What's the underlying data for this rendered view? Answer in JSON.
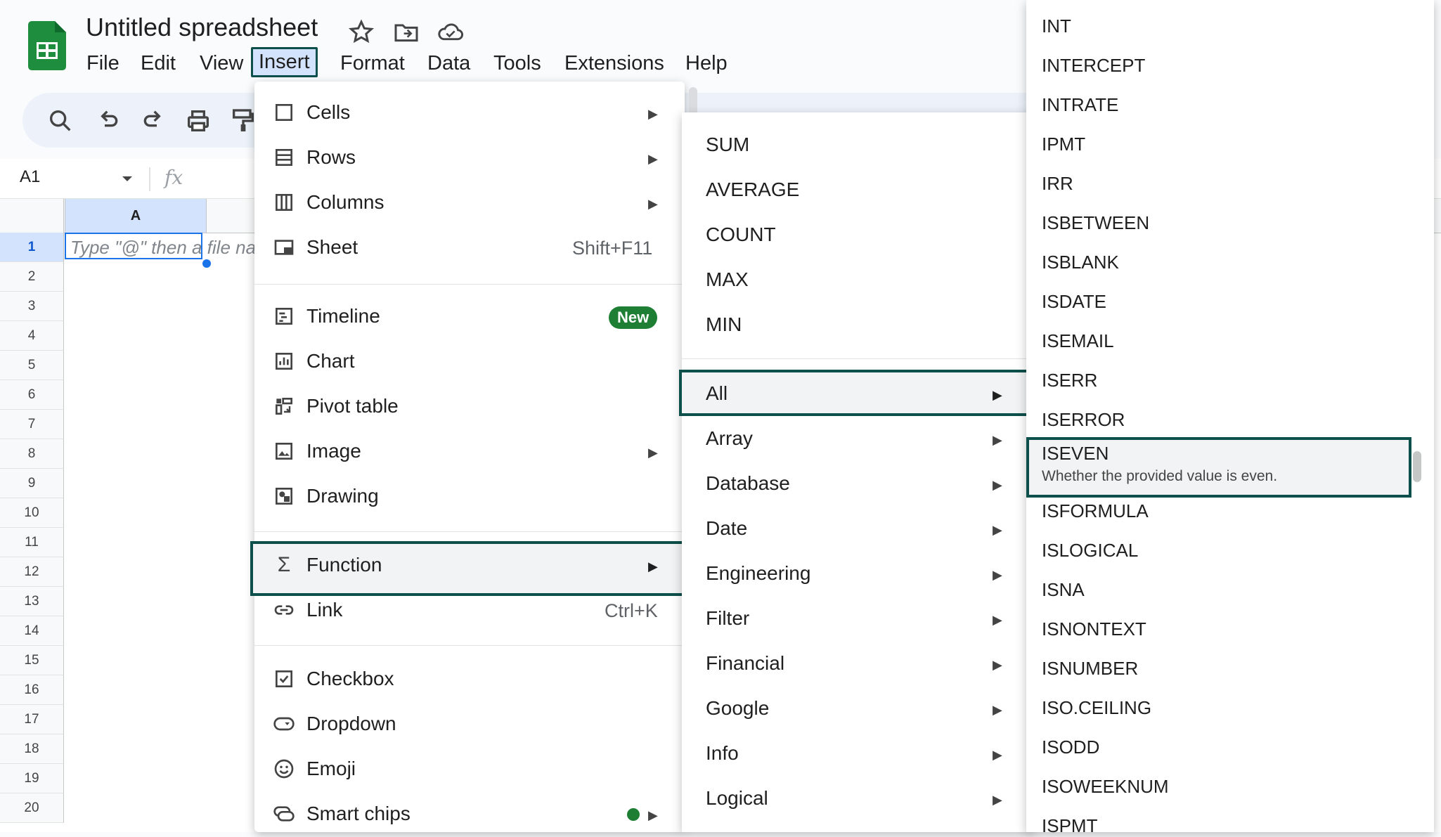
{
  "app": {
    "title": "Untitled spreadsheet",
    "menubar": [
      "File",
      "Edit",
      "View",
      "Insert",
      "Format",
      "Data",
      "Tools",
      "Extensions",
      "Help"
    ],
    "active_menu": "Insert"
  },
  "formula_bar": {
    "name_box": "A1",
    "fx": "fx"
  },
  "grid": {
    "column_header": "A",
    "rows": [
      "1",
      "2",
      "3",
      "4",
      "5",
      "6",
      "7",
      "8",
      "9",
      "10",
      "11",
      "12",
      "13",
      "14",
      "15",
      "16",
      "17",
      "18",
      "19",
      "20"
    ],
    "a1_placeholder": "Type \"@\" then a file na"
  },
  "insert_menu": {
    "items": [
      {
        "label": "Cells",
        "icon": "cells-icon",
        "submenu": true
      },
      {
        "label": "Rows",
        "icon": "rows-icon",
        "submenu": true
      },
      {
        "label": "Columns",
        "icon": "columns-icon",
        "submenu": true
      },
      {
        "label": "Sheet",
        "icon": "sheet-icon",
        "shortcut": "Shift+F11"
      },
      {
        "label": "Timeline",
        "icon": "timeline-icon",
        "badge": "New"
      },
      {
        "label": "Chart",
        "icon": "chart-icon"
      },
      {
        "label": "Pivot table",
        "icon": "pivot-table-icon"
      },
      {
        "label": "Image",
        "icon": "image-icon",
        "submenu": true
      },
      {
        "label": "Drawing",
        "icon": "drawing-icon"
      },
      {
        "label": "Function",
        "icon": "sigma-icon",
        "submenu": true
      },
      {
        "label": "Link",
        "icon": "link-icon",
        "shortcut": "Ctrl+K"
      },
      {
        "label": "Checkbox",
        "icon": "checkbox-icon"
      },
      {
        "label": "Dropdown",
        "icon": "dropdown-icon"
      },
      {
        "label": "Emoji",
        "icon": "emoji-icon"
      },
      {
        "label": "Smart chips",
        "icon": "smart-chips-icon",
        "submenu": true
      }
    ]
  },
  "function_menu": {
    "common": [
      "SUM",
      "AVERAGE",
      "COUNT",
      "MAX",
      "MIN"
    ],
    "categories": [
      "All",
      "Array",
      "Database",
      "Date",
      "Engineering",
      "Filter",
      "Financial",
      "Google",
      "Info",
      "Logical"
    ]
  },
  "all_functions": {
    "items": [
      "INT",
      "INTERCEPT",
      "INTRATE",
      "IPMT",
      "IRR",
      "ISBETWEEN",
      "ISBLANK",
      "ISDATE",
      "ISEMAIL",
      "ISERR",
      "ISERROR",
      "ISEVEN",
      "ISFORMULA",
      "ISLOGICAL",
      "ISNA",
      "ISNONTEXT",
      "ISNUMBER",
      "ISO.CEILING",
      "ISODD",
      "ISOWEEKNUM",
      "ISPMT"
    ],
    "highlighted": "ISEVEN",
    "highlighted_desc": "Whether the provided value is even."
  },
  "colors": {
    "accent": "#0d4f4a",
    "brand_green": "#1e8e3e",
    "badge": "#1e7e34",
    "selection": "#1a73e8"
  }
}
